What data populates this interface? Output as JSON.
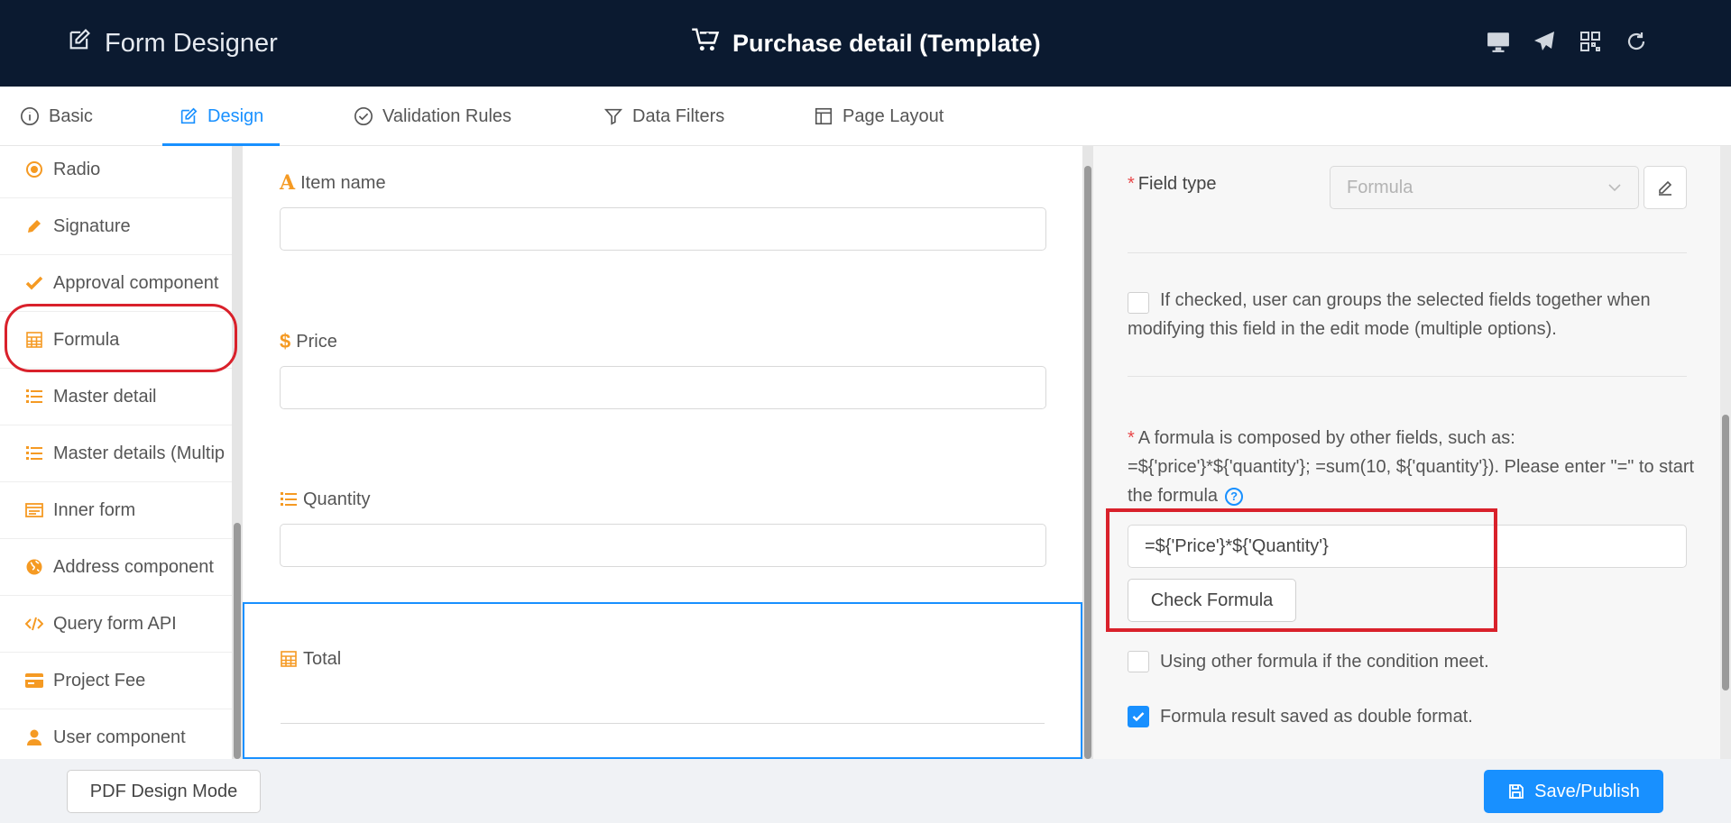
{
  "header": {
    "brand": "Form Designer",
    "title": "Purchase detail (Template)",
    "tools": [
      "desktop-icon",
      "send-icon",
      "qrcode-icon",
      "refresh-icon"
    ]
  },
  "tabs": [
    {
      "label": "Basic",
      "icon": "info-circle-icon"
    },
    {
      "label": "Design",
      "icon": "edit-icon",
      "active": true
    },
    {
      "label": "Validation Rules",
      "icon": "check-circle-icon"
    },
    {
      "label": "Data Filters",
      "icon": "filter-icon"
    },
    {
      "label": "Page Layout",
      "icon": "layout-icon"
    }
  ],
  "components": [
    {
      "label": "Radio",
      "icon": "radio-icon"
    },
    {
      "label": "Signature",
      "icon": "pen-icon"
    },
    {
      "label": "Approval component",
      "icon": "check-icon"
    },
    {
      "label": "Formula",
      "icon": "calculator-icon"
    },
    {
      "label": "Master detail",
      "icon": "list-icon"
    },
    {
      "label": "Master details (Multip",
      "icon": "list-icon"
    },
    {
      "label": "Inner form",
      "icon": "form-icon"
    },
    {
      "label": "Address component",
      "icon": "globe-icon"
    },
    {
      "label": "Query form API",
      "icon": "code-icon"
    },
    {
      "label": "Project Fee",
      "icon": "card-icon"
    },
    {
      "label": "User component",
      "icon": "user-icon"
    }
  ],
  "canvas": {
    "fields": [
      {
        "label": "Item name",
        "icon": "text-icon"
      },
      {
        "label": "Price",
        "icon": "dollar-icon"
      },
      {
        "label": "Quantity",
        "icon": "list-icon"
      },
      {
        "label": "Total",
        "icon": "calculator-icon"
      }
    ]
  },
  "properties": {
    "field_type_label": "Field type",
    "field_type_value": "Formula",
    "group_checkbox_text": "If checked, user can groups the selected fields together when modifying this field in the edit mode (multiple options).",
    "formula_hint": "A formula is composed by other fields, such as: =${'price'}*${'quantity'}; =sum(10, ${'quantity'}). Please enter \"=\" to start the formula",
    "formula_value": "=${'Price'}*${'Quantity'}",
    "check_formula_label": "Check Formula",
    "other_formula_text": "Using other formula if the condition meet.",
    "double_format_text": "Formula result saved as double format.",
    "double_format_checked": true
  },
  "footer": {
    "pdf_label": "PDF Design Mode",
    "save_label": "Save/Publish"
  },
  "colors": {
    "header_bg": "#0b1a30",
    "accent": "#1890ff",
    "icon_orange": "#f59a23",
    "highlight_red": "#d9212b"
  }
}
